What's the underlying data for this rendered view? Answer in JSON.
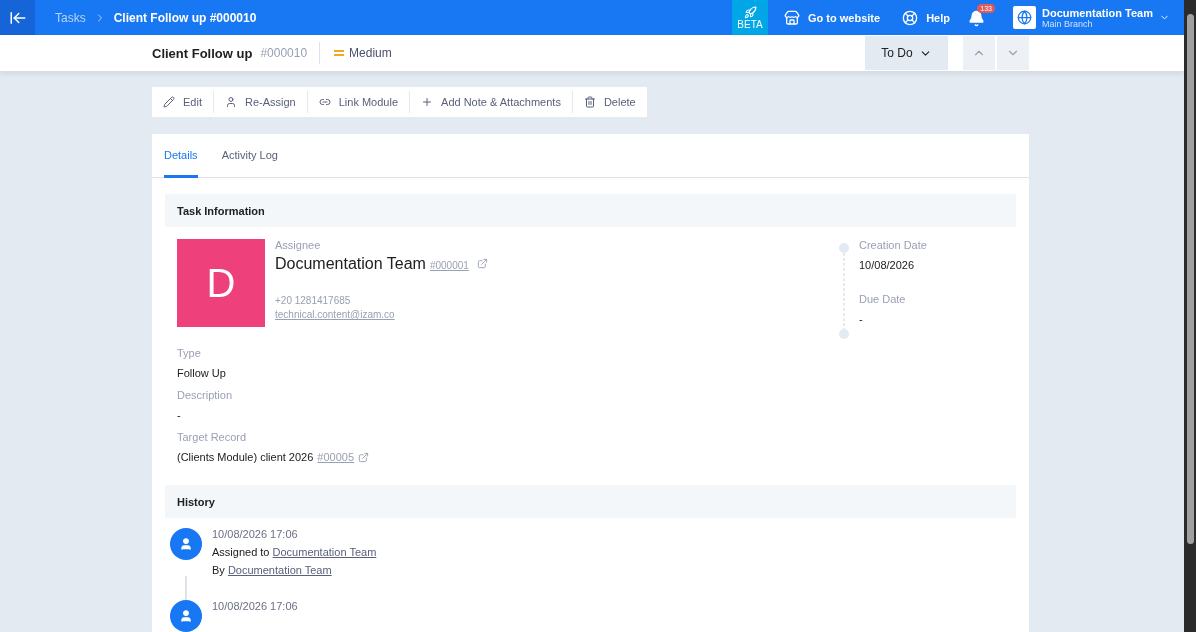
{
  "topbar": {
    "breadcrumb": [
      "Tasks",
      "Client Follow up #000010"
    ],
    "beta": "BETA",
    "website": "Go to website",
    "help": "Help",
    "notifications": "133",
    "account": {
      "name": "Documentation Team",
      "branch": "Main Branch"
    }
  },
  "header": {
    "title": "Client Follow up",
    "number": "#000010",
    "priority": "Medium",
    "status": "To Do"
  },
  "actions": [
    {
      "kind": "edit",
      "label": "Edit"
    },
    {
      "kind": "user",
      "label": "Re-Assign"
    },
    {
      "kind": "link",
      "label": "Link Module"
    },
    {
      "kind": "add",
      "label": "Add Note & Attachments"
    },
    {
      "kind": "delete",
      "label": "Delete"
    }
  ],
  "tabs": [
    {
      "label": "Details",
      "selected": true
    },
    {
      "label": "Activity Log",
      "selected": false
    }
  ],
  "task_information": {
    "heading": "Task Information",
    "avatar_letter": "D",
    "assignee_label": "Assignee",
    "assignee": "Documentation Team",
    "assignee_code": "#000001",
    "phone": "+20 1281417685",
    "email": "technical.content@izam.co",
    "dates": [
      {
        "label": "Creation Date",
        "value": "10/08/2026"
      },
      {
        "label": "Due Date",
        "value": "-"
      }
    ],
    "fields": [
      {
        "label": "Type",
        "value": "Follow Up"
      },
      {
        "label": "Description",
        "value": "-"
      },
      {
        "label": "Target Record",
        "value": "(Clients Module) client 2026",
        "link": "#00005"
      }
    ]
  },
  "history": {
    "heading": "History",
    "entries": [
      {
        "time": "10/08/2026 17:06",
        "action": "Assigned to",
        "target": "Documentation Team",
        "by_label": "By",
        "by": "Documentation Team"
      },
      {
        "time": "10/08/2026 17:06"
      }
    ]
  }
}
